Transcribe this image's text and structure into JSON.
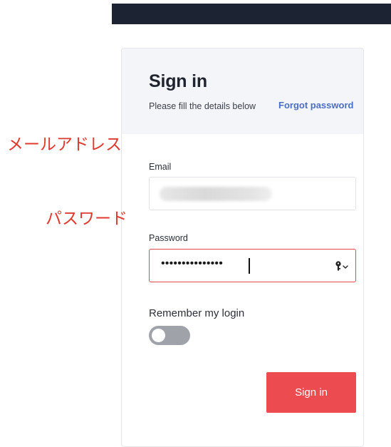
{
  "header": {
    "title": "Sign in",
    "subtitle": "Please fill the details below",
    "forgot_link": "Forgot password"
  },
  "form": {
    "email_label": "Email",
    "password_label": "Password",
    "password_value": "•••••••••••••••",
    "remember_label": "Remember my login",
    "remember_on": false,
    "submit_label": "Sign in"
  },
  "annotations": {
    "email": "メールアドレス",
    "password": "パスワード"
  },
  "icons": {
    "password_field": "key-dropdown-icon"
  },
  "colors": {
    "topbar": "#1c2333",
    "link": "#4a6ec7",
    "button": "#ec4b4f",
    "error_border": "#e04a4a",
    "annotation": "#e03a2e"
  }
}
